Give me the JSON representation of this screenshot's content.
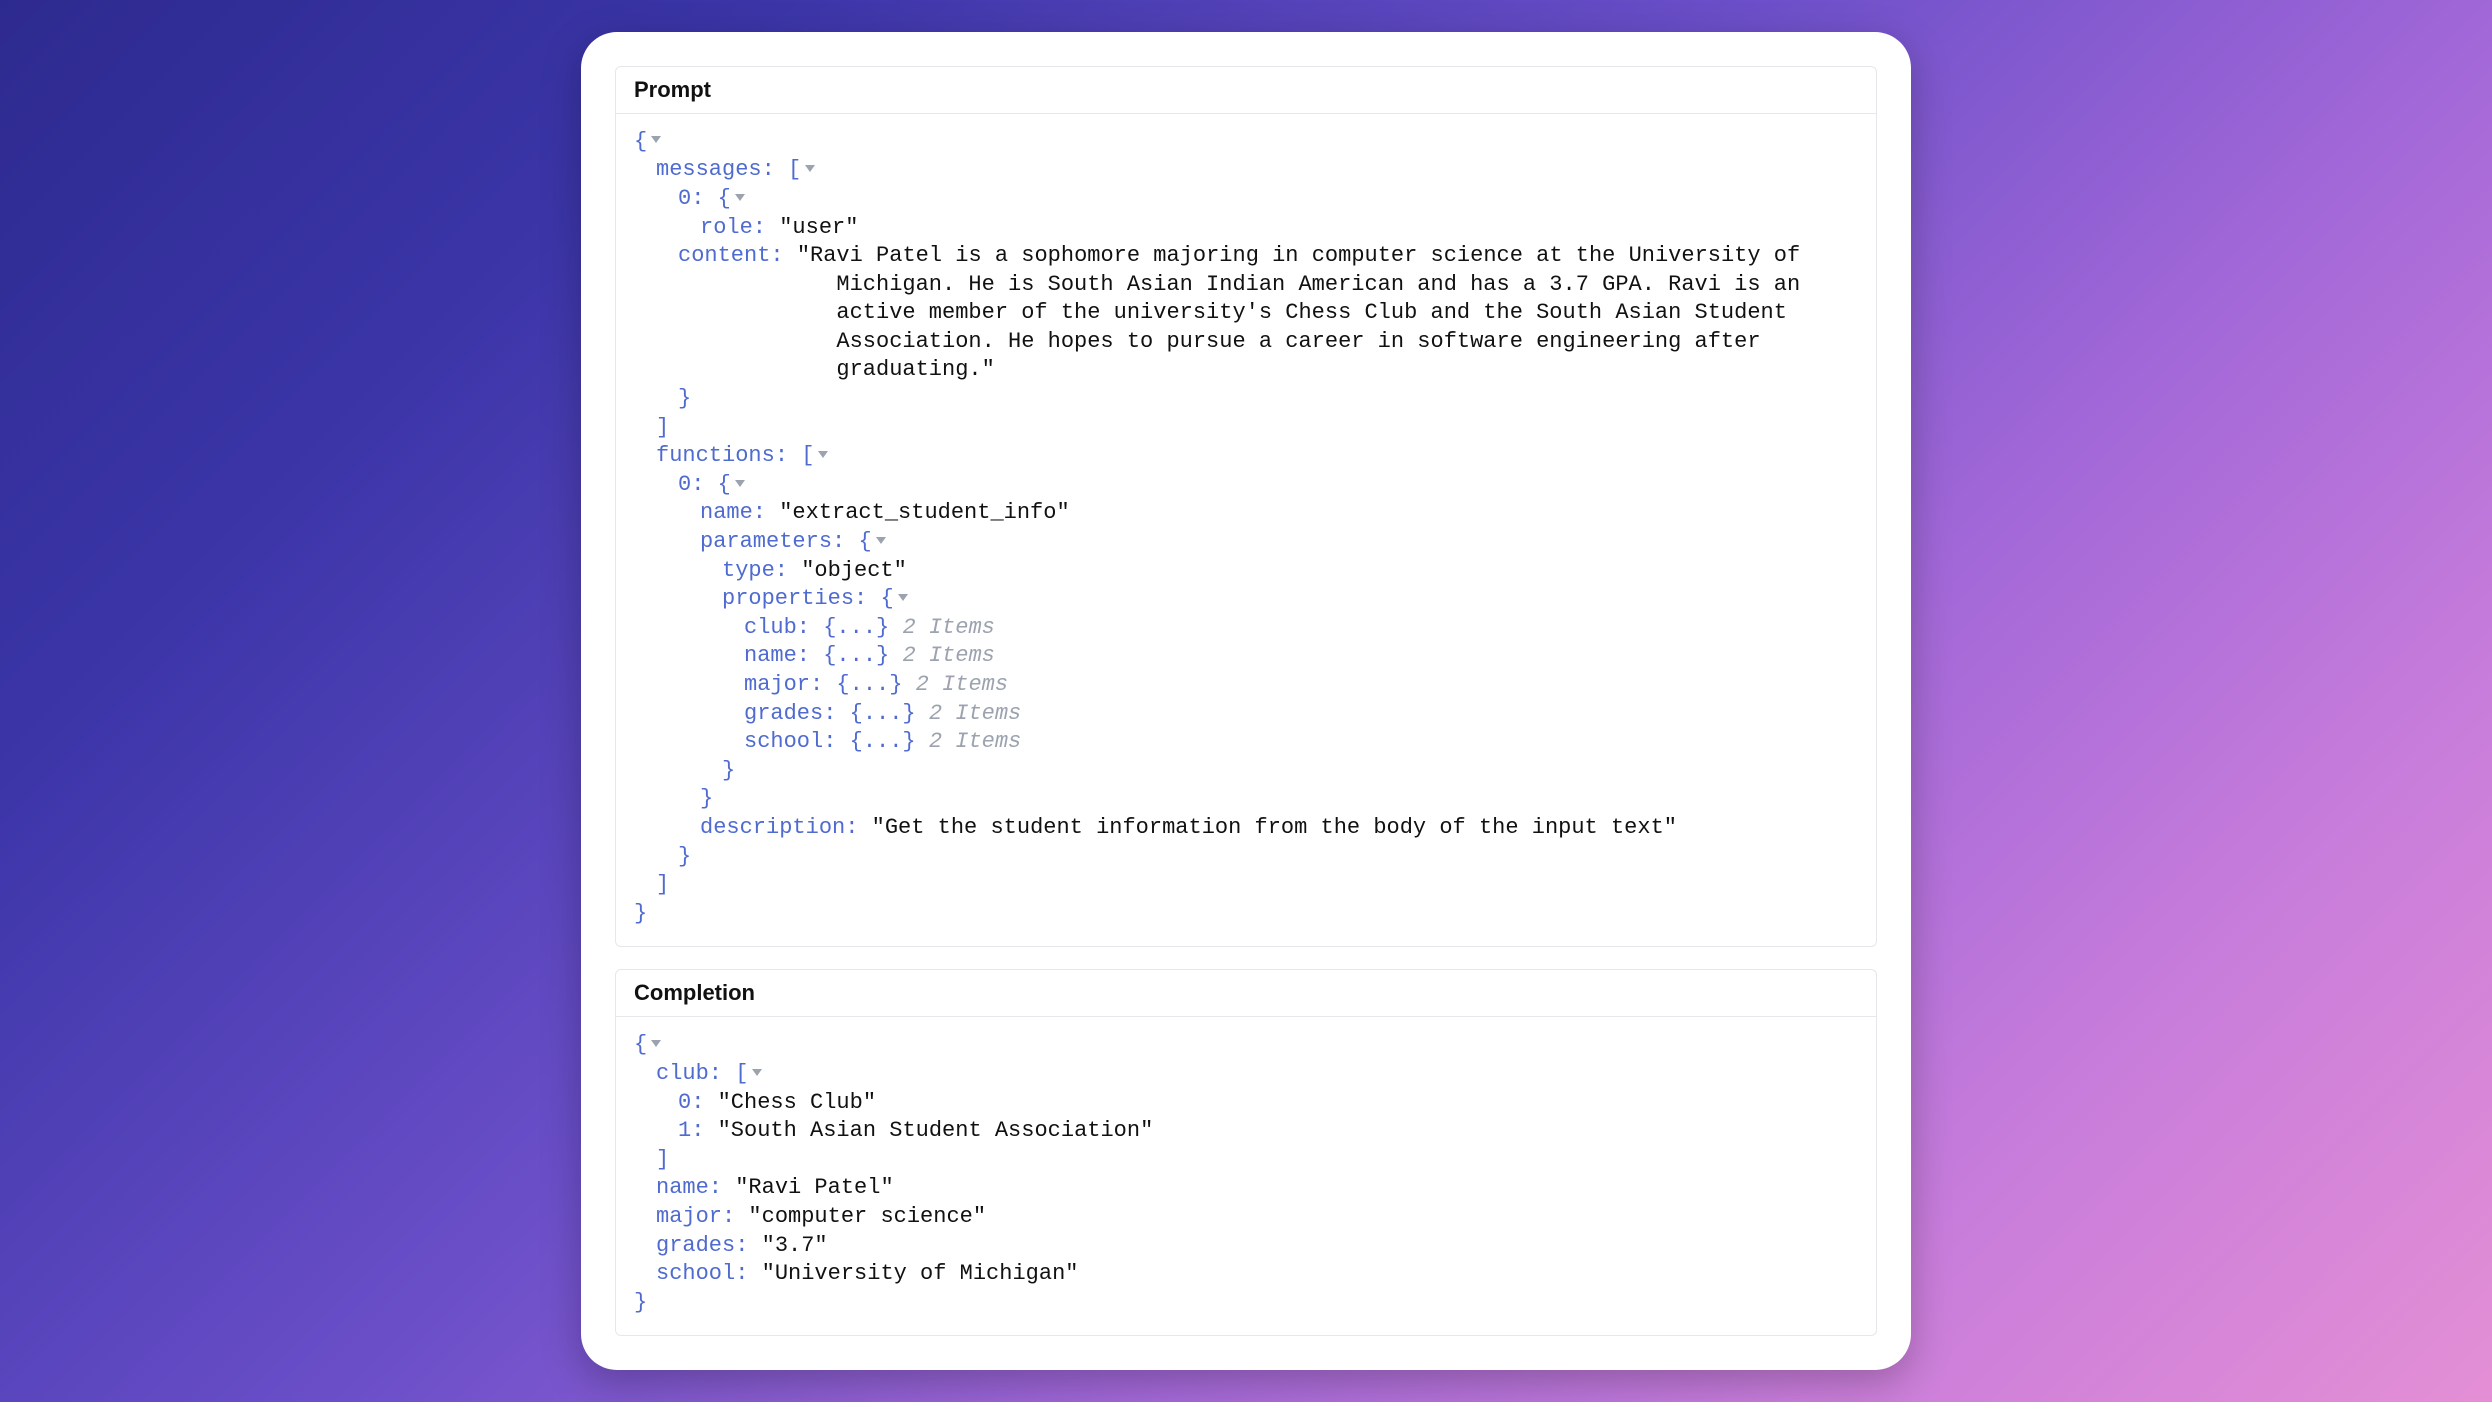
{
  "prompt": {
    "title": "Prompt",
    "messages_key": "messages:",
    "msg_index": "0:",
    "role_key": "role:",
    "role_value": "\"user\"",
    "content_key": "content:",
    "content_value": "\"Ravi Patel is a sophomore majoring in computer science at the University of Michigan. He is South Asian Indian American and has a 3.7 GPA. Ravi is an active member of the university's Chess Club and the South Asian Student Association. He hopes to pursue a career in software engineering after graduating.\"",
    "functions_key": "functions:",
    "func_index": "0:",
    "name_key": "name:",
    "name_value": "\"extract_student_info\"",
    "parameters_key": "parameters:",
    "type_key": "type:",
    "type_value": "\"object\"",
    "properties_key": "properties:",
    "prop_club": "club:",
    "prop_name": "name:",
    "prop_major": "major:",
    "prop_grades": "grades:",
    "prop_school": "school:",
    "collapsed_obj": "{...}",
    "items_hint": "2 Items",
    "description_key": "description:",
    "description_value": "\"Get the student information from the body of the input text\""
  },
  "completion": {
    "title": "Completion",
    "club_key": "club:",
    "club_idx0": "0:",
    "club_val0": "\"Chess Club\"",
    "club_idx1": "1:",
    "club_val1": "\"South Asian Student Association\"",
    "name_key": "name:",
    "name_value": "\"Ravi Patel\"",
    "major_key": "major:",
    "major_value": "\"computer science\"",
    "grades_key": "grades:",
    "grades_value": "\"3.7\"",
    "school_key": "school:",
    "school_value": "\"University of Michigan\""
  },
  "tokens": {
    "open_brace": "{",
    "close_brace": "}",
    "open_bracket": "[",
    "close_bracket": "]"
  }
}
